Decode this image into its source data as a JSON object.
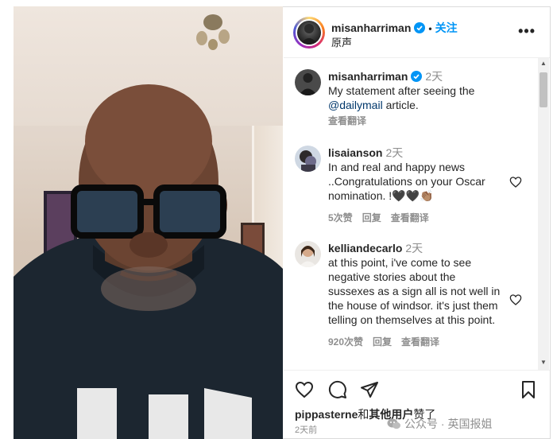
{
  "header": {
    "username": "misanharriman",
    "dot": "•",
    "follow_label": "关注",
    "subtitle": "原声",
    "more_label": "•••"
  },
  "comments": [
    {
      "username": "misanharriman",
      "time": "2天",
      "text_before": "My statement after seeing the ",
      "mention": "@dailymail",
      "text_after": " article.",
      "translate": "查看翻译"
    },
    {
      "username": "lisaianson",
      "time": "2天",
      "text": "In and real and happy news ..Congratulations on your Oscar nomination. !🖤🖤👏🏽",
      "likes": "5次赞",
      "reply": "回复",
      "translate": "查看翻译"
    },
    {
      "username": "kelliandecarlo",
      "time": "2天",
      "text": "at this point, i've come to see negative stories about the sussexes as a sign all is not well in the house of windsor. it's just them telling on themselves at this point.",
      "likes": "920次赞",
      "reply": "回复",
      "translate": "查看翻译"
    }
  ],
  "footer": {
    "liked_user": "pippasterne",
    "liked_and": "和",
    "liked_others": "其他用户",
    "liked_suffix": "赞了",
    "date": "2天前",
    "watermark": "公众号 · 英国报姐"
  },
  "icons": {
    "verified": "verified-badge-icon",
    "heart": "heart-icon",
    "comment": "comment-icon",
    "share": "share-icon",
    "save": "bookmark-icon"
  },
  "colors": {
    "accent": "#0095f6",
    "muted": "#8e8e8e",
    "text": "#262626"
  }
}
